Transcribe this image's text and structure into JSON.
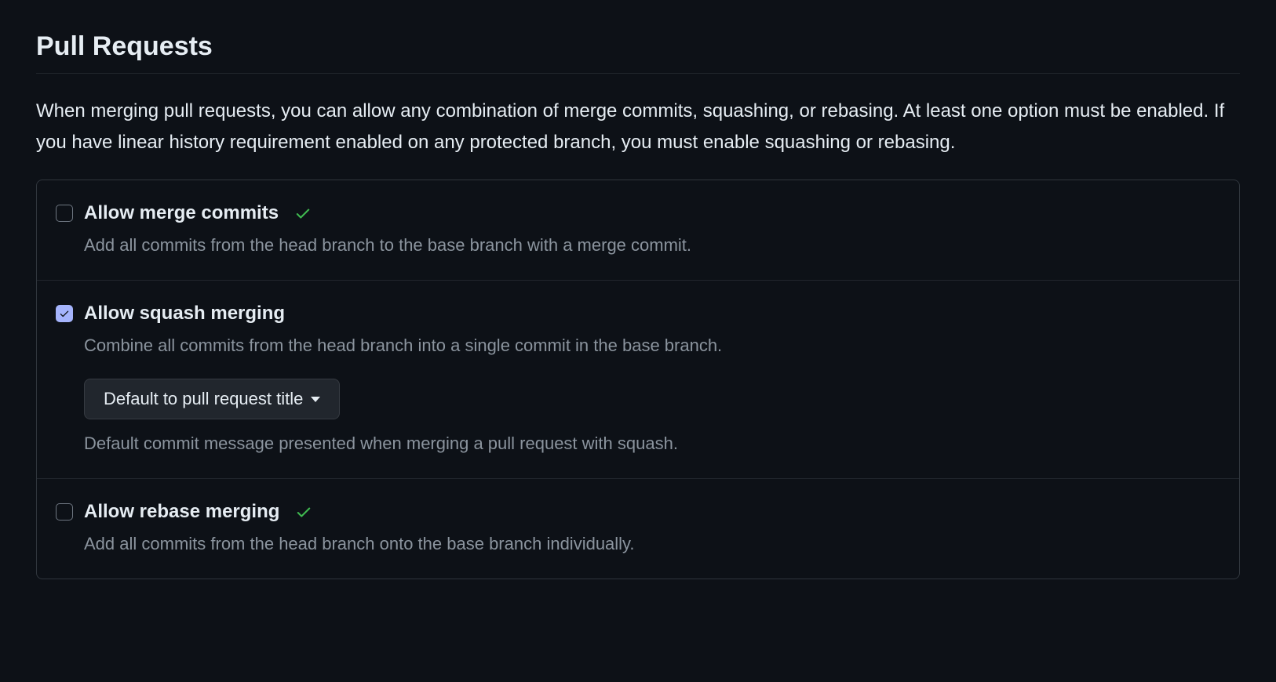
{
  "section": {
    "title": "Pull Requests",
    "description": "When merging pull requests, you can allow any combination of merge commits, squashing, or rebasing. At least one option must be enabled. If you have linear history requirement enabled on any protected branch, you must enable squashing or rebasing."
  },
  "options": {
    "merge_commits": {
      "label": "Allow merge commits",
      "description": "Add all commits from the head branch to the base branch with a merge commit.",
      "checked": false,
      "show_success_check": true
    },
    "squash": {
      "label": "Allow squash merging",
      "description": "Combine all commits from the head branch into a single commit in the base branch.",
      "checked": true,
      "show_success_check": false,
      "default_dropdown": "Default to pull request title",
      "default_desc": "Default commit message presented when merging a pull request with squash."
    },
    "rebase": {
      "label": "Allow rebase merging",
      "description": "Add all commits from the head branch onto the base branch individually.",
      "checked": false,
      "show_success_check": true
    }
  },
  "colors": {
    "success_check": "#3fb950",
    "checkbox_checked_bg": "#a5b4fc"
  }
}
